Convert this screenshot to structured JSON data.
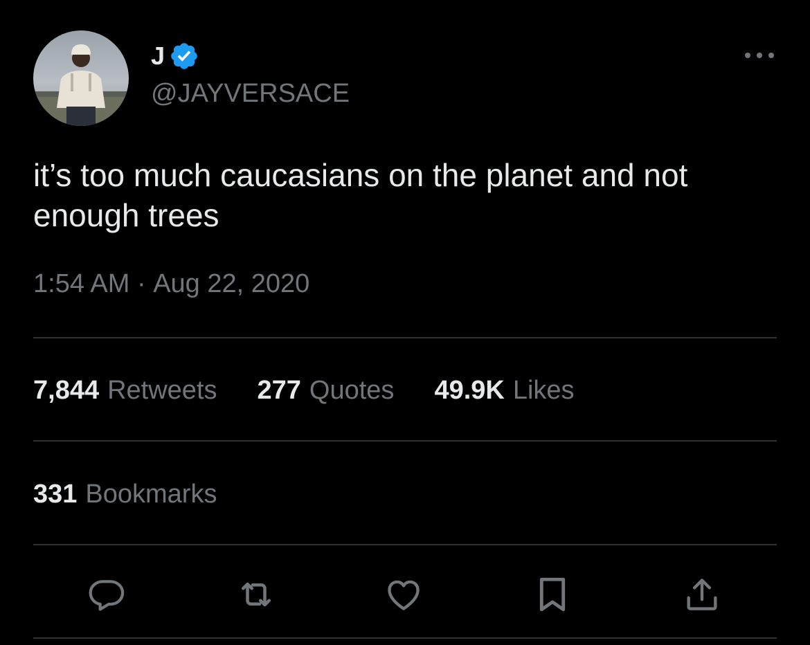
{
  "tweet": {
    "display_name": "J",
    "handle": "@JAYVERSACE",
    "text": "it’s too much caucasians on the planet and not enough trees",
    "time": "1:54 AM",
    "separator": " · ",
    "date": "Aug 22, 2020"
  },
  "stats": {
    "retweets": {
      "count": "7,844",
      "label": "Retweets"
    },
    "quotes": {
      "count": "277",
      "label": "Quotes"
    },
    "likes": {
      "count": "49.9K",
      "label": "Likes"
    },
    "bookmarks": {
      "count": "331",
      "label": "Bookmarks"
    }
  },
  "icons": {
    "verified": "verified-badge-icon",
    "more": "more-options-icon",
    "reply": "reply-icon",
    "retweet": "retweet-icon",
    "like": "heart-icon",
    "bookmark": "bookmark-icon",
    "share": "share-icon"
  },
  "colors": {
    "background": "#000000",
    "text_primary": "#e7e9ea",
    "text_secondary": "#71767b",
    "verified": "#1d9bf0",
    "divider": "#2f3336"
  }
}
